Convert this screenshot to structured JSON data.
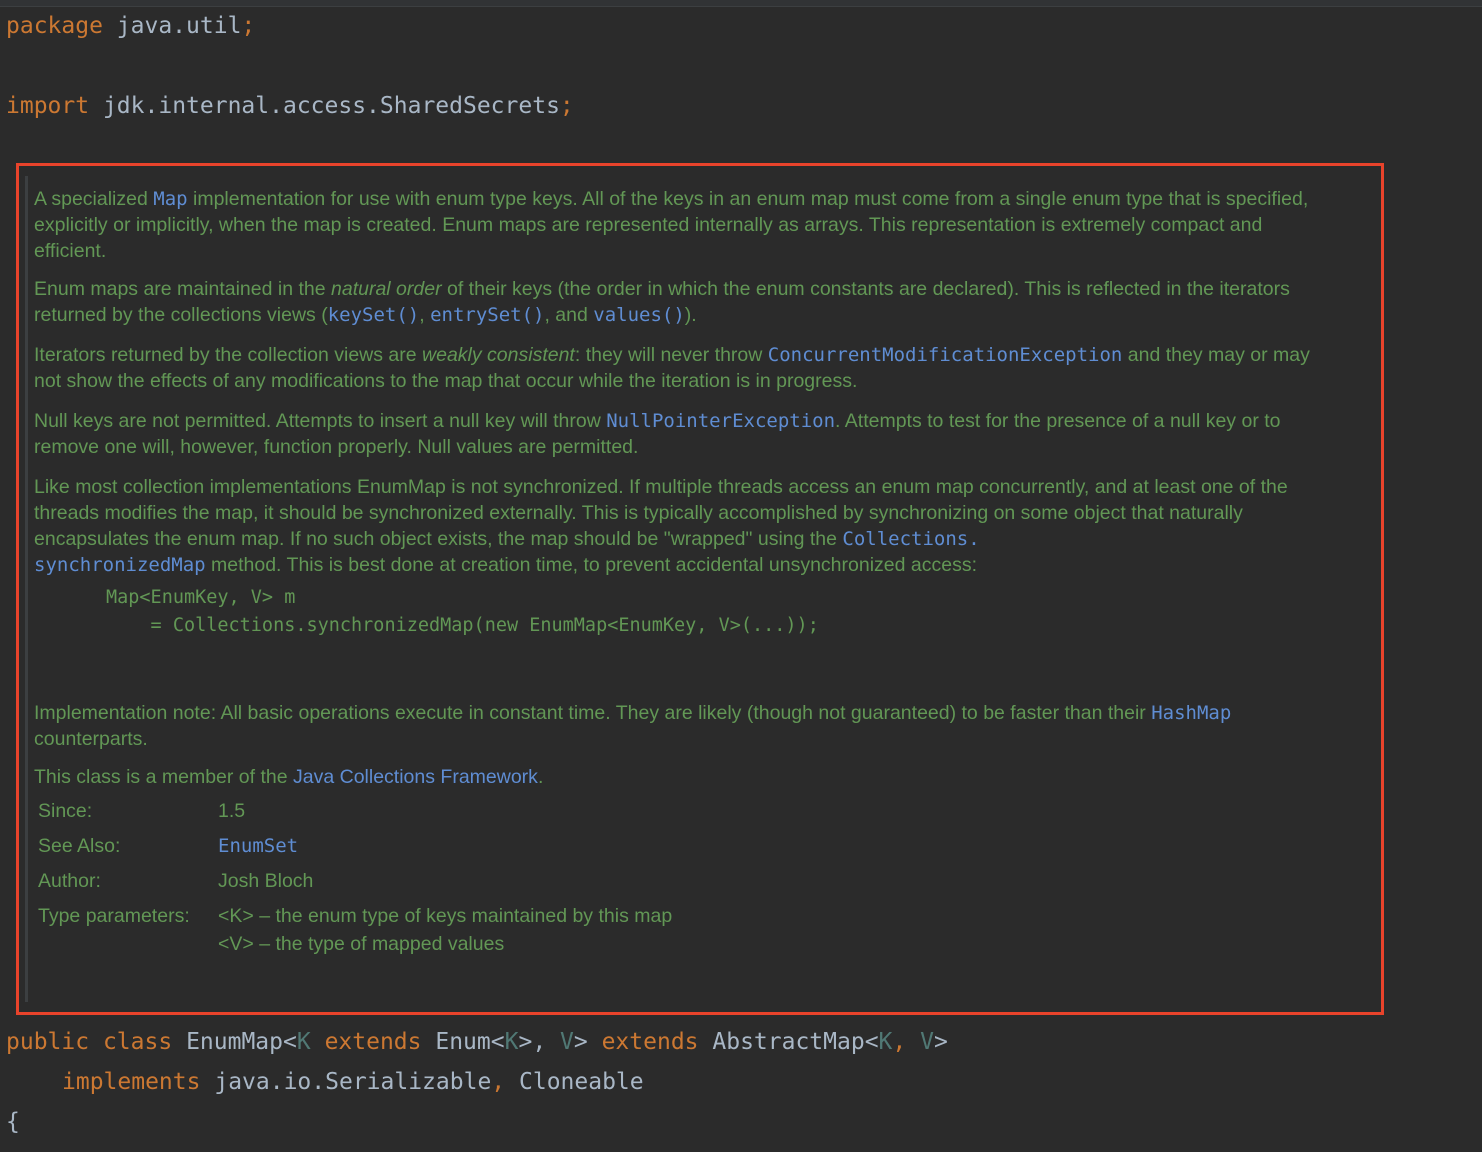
{
  "code": {
    "package_kw": "package",
    "package_name": "java.util",
    "semicolon": ";",
    "import_kw": "import",
    "import_name": "jdk.internal.access.SharedSecrets",
    "decl": {
      "public_kw": "public",
      "class_kw": "class",
      "class_name": "EnumMap<",
      "k": "K",
      "extends_kw": "extends",
      "enum_part": "Enum<",
      "k2": "K",
      "close_comma": ">, ",
      "v": "V",
      "close_space": "> ",
      "extends_kw2": "extends",
      "abstract_map": "AbstractMap<",
      "k3": "K",
      "comma": ", ",
      "v2": "V",
      "close": ">",
      "implements_kw": "implements",
      "serializable": "java.io.Serializable",
      "comma2": ", ",
      "cloneable": "Cloneable",
      "brace": "{"
    }
  },
  "doc": {
    "p1_a": "A specialized ",
    "p1_link": "Map",
    "p1_b": " implementation for use with enum type keys. All of the keys in an enum map must come from a single enum type that is specified, explicitly or implicitly, when the map is created. Enum maps are represented internally as arrays. This representation is extremely compact and efficient.",
    "p2_a": "Enum maps are maintained in the ",
    "p2_em": "natural order",
    "p2_b": " of their keys (the order in which the enum constants are declared). This is reflected in the iterators returned by the collections views (",
    "p2_l1": "keySet()",
    "p2_c": ", ",
    "p2_l2": "entrySet()",
    "p2_d": ", and ",
    "p2_l3": "values()",
    "p2_e": ").",
    "p3_a": "Iterators returned by the collection views are ",
    "p3_em": "weakly consistent",
    "p3_b": ": they will never throw ",
    "p3_link": "ConcurrentModificationException",
    "p3_c": " and they may or may not show the effects of any modifications to the map that occur while the iteration is in progress.",
    "p4_a": "Null keys are not permitted. Attempts to insert a null key will throw ",
    "p4_link": "NullPointerException",
    "p4_b": ". Attempts to test for the presence of a null key or to remove one will, however, function properly. Null values are permitted.",
    "p5_a": "Like most collection implementations EnumMap is not synchronized. If multiple threads access an enum map concurrently, and at least one of the threads modifies the map, it should be synchronized externally. This is typically accomplished by synchronizing on some object that naturally encapsulates the enum map. If no such object exists, the map should be \"wrapped\" using the ",
    "p5_link": "Collections.\nsynchronizedMap",
    "p5_b": " method. This is best done at creation time, to prevent accidental unsynchronized access:",
    "snippet": "Map<EnumKey, V> m\n    = Collections.synchronizedMap(new EnumMap<EnumKey, V>(...));",
    "p6_a": "Implementation note: All basic operations execute in constant time. They are likely (though not guaranteed) to be faster than their ",
    "p6_link": "HashMap",
    "p6_b": " counterparts.",
    "p7_a": "This class is a member of the ",
    "p7_link": "Java Collections Framework",
    "p7_b": ".",
    "since_label": "Since:",
    "since_value": "1.5",
    "see_label": "See Also:",
    "see_value": "EnumSet",
    "author_label": "Author:",
    "author_value": "Josh Bloch",
    "type_label": "Type parameters:",
    "type_k": "<K> – the enum type of keys maintained by this map",
    "type_v": "<V> – the type of mapped values"
  },
  "colors": {
    "background": "#2b2b2b",
    "keyword": "#cc7832",
    "identifier": "#a9b7c6",
    "type_param": "#507874",
    "doc_text": "#629755",
    "doc_link": "#5f8dd3",
    "highlight_border": "#e8432b"
  }
}
